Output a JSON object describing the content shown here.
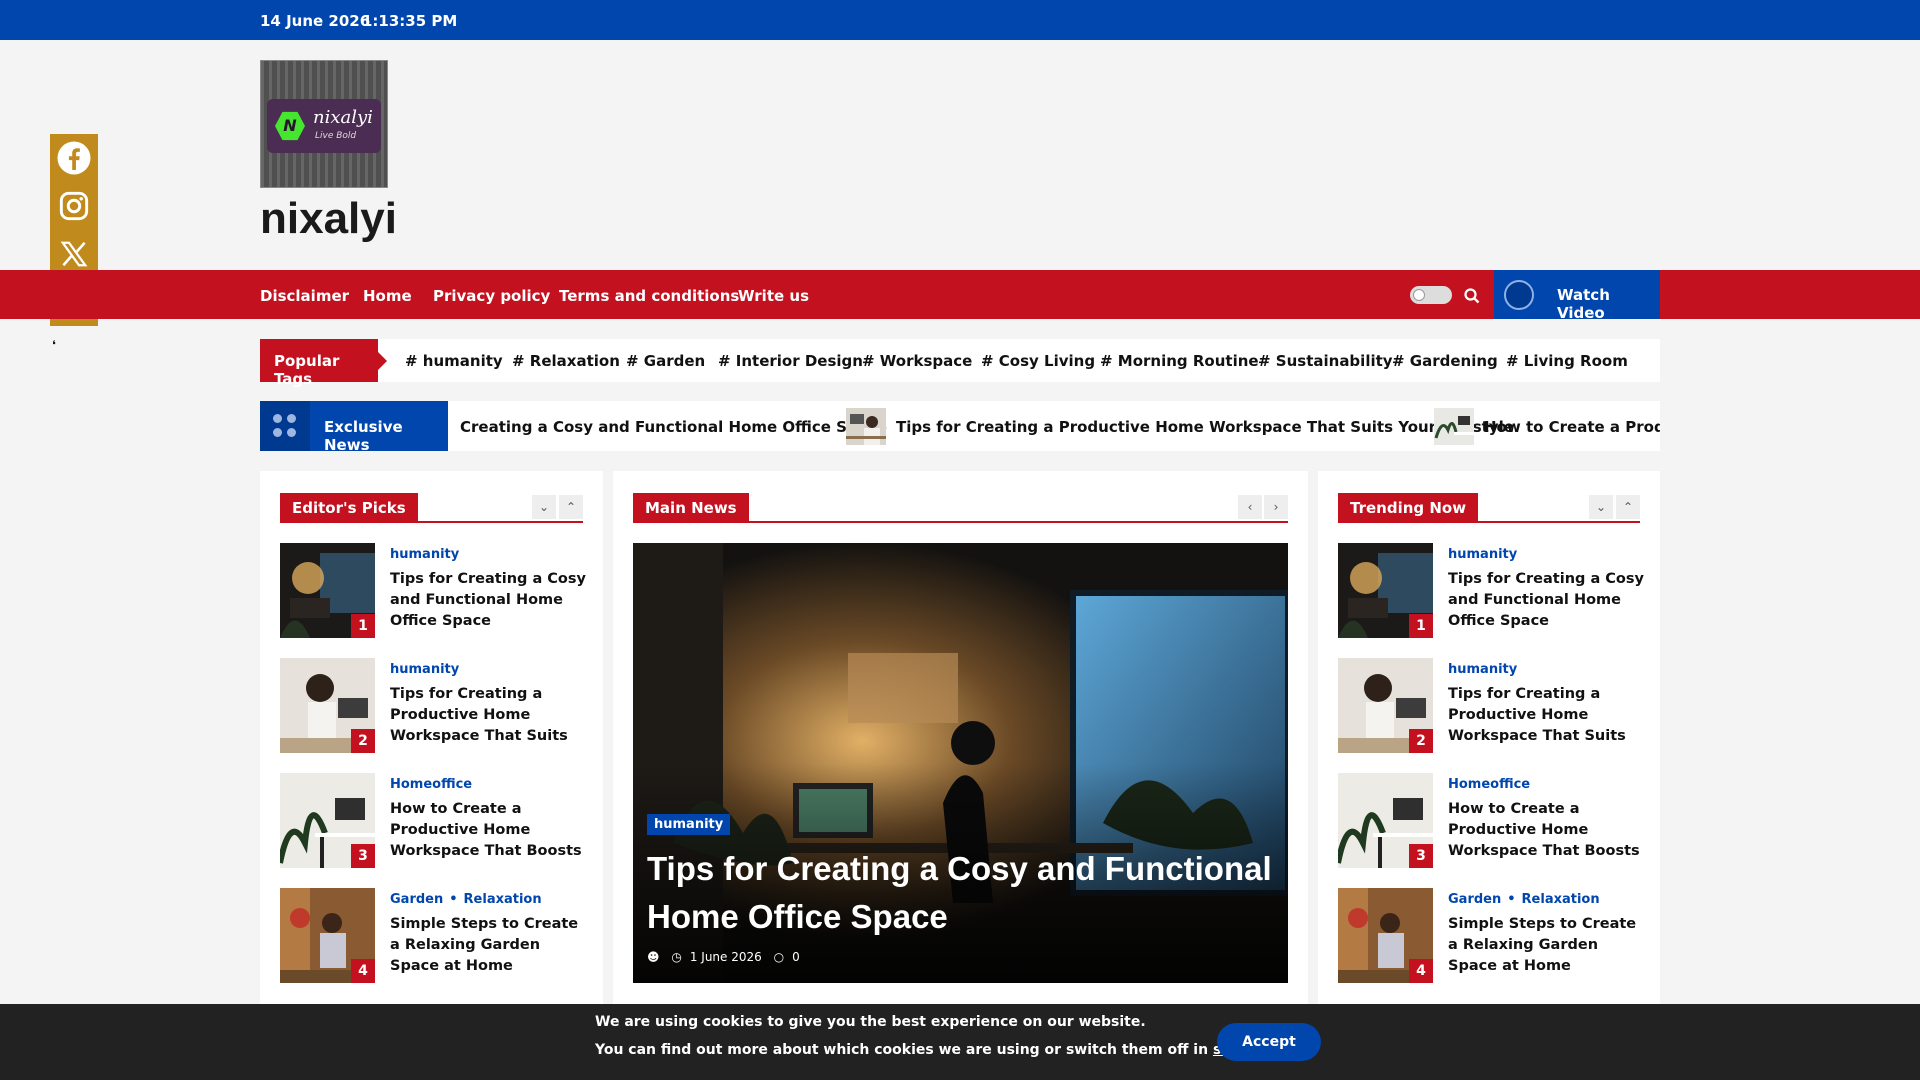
{
  "topbar": {
    "date": "14 June 2026",
    "time": "1:13:35 PM"
  },
  "site": {
    "logo_name": "nixalyi",
    "logo_tagline": "Live Bold",
    "logo_letter": "N",
    "title": "nixalyi"
  },
  "social": {
    "items": [
      "facebook-icon",
      "instagram-icon",
      "x-icon",
      "plus-icon"
    ],
    "hide_glyph": "❛"
  },
  "nav": {
    "items": [
      "Disclaimer",
      "Home",
      "Privacy policy",
      "Terms and conditions",
      "Write us"
    ],
    "watch_video": "Watch Video"
  },
  "popular_tags": {
    "label": "Popular Tags",
    "tags": [
      "# humanity",
      "# Relaxation",
      "# Garden",
      "# Interior Design",
      "# Workspace",
      "# Cosy Living",
      "# Morning Routine",
      "# Sustainability",
      "# Gardening",
      "# Living Room"
    ]
  },
  "exclusive": {
    "label": "Exclusive News",
    "items": [
      "Creating a Cosy and Functional Home Office Space",
      "Tips for Creating a Productive Home Workspace That Suits Your Lifestyle",
      "How to Create a Product"
    ]
  },
  "editors_picks": {
    "title": "Editor's Picks",
    "items": [
      {
        "num": "1",
        "cats": [
          "humanity"
        ],
        "title": "Tips for Creating a Cosy and Functional Home Office Space"
      },
      {
        "num": "2",
        "cats": [
          "humanity"
        ],
        "title": "Tips for Creating a Productive Home Workspace That Suits Your"
      },
      {
        "num": "3",
        "cats": [
          "Homeoffice"
        ],
        "title": "How to Create a Productive Home Workspace That Boosts Focus and Comfort"
      },
      {
        "num": "4",
        "cats": [
          "Garden",
          "Relaxation"
        ],
        "title": "Simple Steps to Create a Relaxing Garden Space at Home"
      }
    ]
  },
  "main_news": {
    "title": "Main News",
    "category": "humanity",
    "headline": "Tips for Creating a Cosy and Functional Home Office Space",
    "date": "1 June 2026",
    "comments": "0"
  },
  "trending": {
    "title": "Trending Now",
    "items": [
      {
        "num": "1",
        "cats": [
          "humanity"
        ],
        "title": "Tips for Creating a Cosy and Functional Home Office Space"
      },
      {
        "num": "2",
        "cats": [
          "humanity"
        ],
        "title": "Tips for Creating a Productive Home Workspace That Suits Your"
      },
      {
        "num": "3",
        "cats": [
          "Homeoffice"
        ],
        "title": "How to Create a Productive Home Workspace That Boosts Focus and Comfort"
      },
      {
        "num": "4",
        "cats": [
          "Garden",
          "Relaxation"
        ],
        "title": "Simple Steps to Create a Relaxing Garden Space at Home"
      }
    ]
  },
  "cookie": {
    "line1": "We are using cookies to give you the best experience on our website.",
    "line2_prefix": "You can find out more about which cookies we are using or switch them off in ",
    "line2_link": "settings",
    "line2_suffix": ".",
    "accept": "Accept"
  },
  "colors": {
    "blue": "#0046ad",
    "red": "#c4111f",
    "social": "#c08b1c"
  }
}
